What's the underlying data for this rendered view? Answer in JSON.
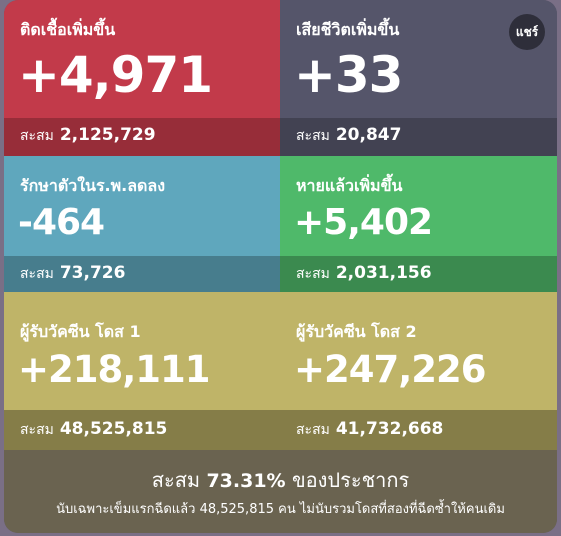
{
  "share": {
    "label": "แชร์"
  },
  "tiles": {
    "new_cases": {
      "label": "ติดเชื้อเพิ่มขึ้น",
      "value": "+4,971",
      "total_label": "สะสม",
      "total": "2,125,729"
    },
    "new_deaths": {
      "label": "เสียชีวิตเพิ่มขึ้น",
      "value": "+33",
      "total_label": "สะสม",
      "total": "20,847"
    },
    "in_hospital": {
      "label": "รักษาตัวในร.พ.ลดลง",
      "value": "-464",
      "total_label": "สะสม",
      "total": "73,726"
    },
    "recovered": {
      "label": "หายแล้วเพิ่มขึ้น",
      "value": "+5,402",
      "total_label": "สะสม",
      "total": "2,031,156"
    },
    "dose1": {
      "label": "ผู้รับวัคซีน โดส 1",
      "value": "+218,111",
      "total_label": "สะสม",
      "total": "48,525,815"
    },
    "dose2": {
      "label": "ผู้รับวัคซีน โดส 2",
      "value": "+247,226",
      "total_label": "สะสม",
      "total": "41,732,668"
    }
  },
  "footer": {
    "prefix": "สะสม",
    "percent": "73.31%",
    "suffix": "ของประชากร",
    "note": "นับเฉพาะเข็มแรกฉีดแล้ว 48,525,815 คน ไม่นับรวมโดสที่สองที่ฉีดซ้ำให้คนเดิม"
  },
  "colors": {
    "new_cases": "#c23a4a",
    "new_deaths": "#55556a",
    "in_hospital": "#5fa7bd",
    "recovered": "#4fb96a",
    "vaccine": "#bfb468"
  }
}
